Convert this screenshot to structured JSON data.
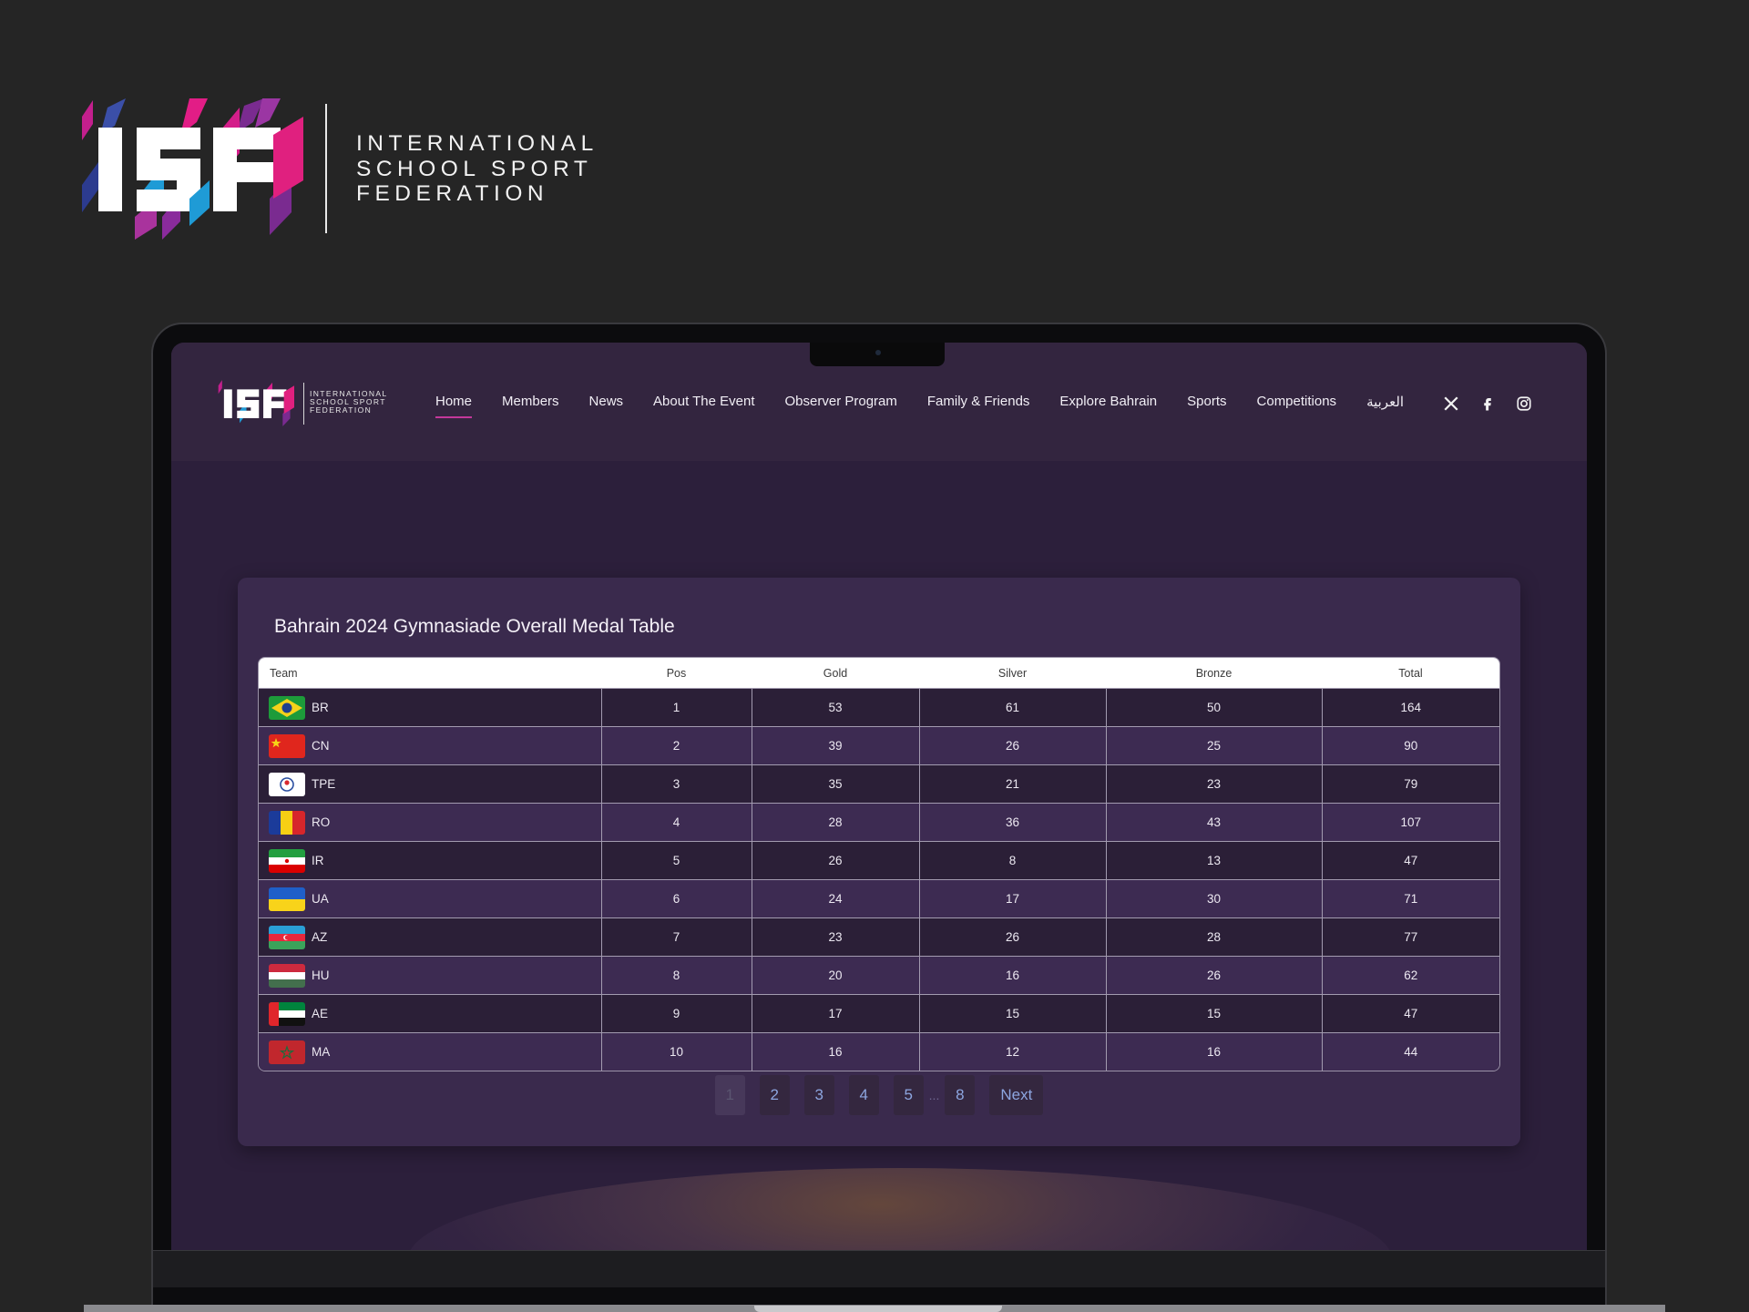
{
  "brand": {
    "lines": [
      "INTERNATIONAL",
      "SCHOOL SPORT",
      "FEDERATION"
    ],
    "mark_text": "ISF"
  },
  "site": {
    "logo_lines": [
      "INTERNATIONAL",
      "SCHOOL SPORT",
      "FEDERATION"
    ],
    "nav": [
      {
        "label": "Home",
        "active": true
      },
      {
        "label": "Members"
      },
      {
        "label": "News"
      },
      {
        "label": "About The Event"
      },
      {
        "label": "Observer Program"
      },
      {
        "label": "Family & Friends"
      },
      {
        "label": "Explore Bahrain"
      },
      {
        "label": "Sports"
      },
      {
        "label": "Competitions"
      },
      {
        "label": "العربية"
      }
    ],
    "social": [
      "x-icon",
      "facebook-icon",
      "instagram-icon"
    ]
  },
  "medal_table": {
    "title": "Bahrain 2024 Gymnasiade Overall Medal Table",
    "columns": [
      "Team",
      "Pos",
      "Gold",
      "Silver",
      "Bronze",
      "Total"
    ],
    "rows": [
      {
        "team": "BR",
        "flag": "brazil-flag-icon",
        "pos": "1",
        "gold": "53",
        "silver": "61",
        "bronze": "50",
        "total": "164"
      },
      {
        "team": "CN",
        "flag": "china-flag-icon",
        "pos": "2",
        "gold": "39",
        "silver": "26",
        "bronze": "25",
        "total": "90"
      },
      {
        "team": "TPE",
        "flag": "chinese-taipei-flag-icon",
        "pos": "3",
        "gold": "35",
        "silver": "21",
        "bronze": "23",
        "total": "79"
      },
      {
        "team": "RO",
        "flag": "romania-flag-icon",
        "pos": "4",
        "gold": "28",
        "silver": "36",
        "bronze": "43",
        "total": "107"
      },
      {
        "team": "IR",
        "flag": "iran-flag-icon",
        "pos": "5",
        "gold": "26",
        "silver": "8",
        "bronze": "13",
        "total": "47"
      },
      {
        "team": "UA",
        "flag": "ukraine-flag-icon",
        "pos": "6",
        "gold": "24",
        "silver": "17",
        "bronze": "30",
        "total": "71"
      },
      {
        "team": "AZ",
        "flag": "azerbaijan-flag-icon",
        "pos": "7",
        "gold": "23",
        "silver": "26",
        "bronze": "28",
        "total": "77"
      },
      {
        "team": "HU",
        "flag": "hungary-flag-icon",
        "pos": "8",
        "gold": "20",
        "silver": "16",
        "bronze": "26",
        "total": "62"
      },
      {
        "team": "AE",
        "flag": "uae-flag-icon",
        "pos": "9",
        "gold": "17",
        "silver": "15",
        "bronze": "15",
        "total": "47"
      },
      {
        "team": "MA",
        "flag": "morocco-flag-icon",
        "pos": "10",
        "gold": "16",
        "silver": "12",
        "bronze": "16",
        "total": "44"
      }
    ]
  },
  "pagination": {
    "pages": [
      "1",
      "2",
      "3",
      "4",
      "5"
    ],
    "ellipsis": "...",
    "last": "8",
    "current": "1",
    "next_label": "Next"
  },
  "colors": {
    "accent": "#c3389a",
    "background": "#252525",
    "screen_bg": "#2c1f3b",
    "card_bg": "#3a2a4d",
    "page_link": "#8da6e0"
  }
}
